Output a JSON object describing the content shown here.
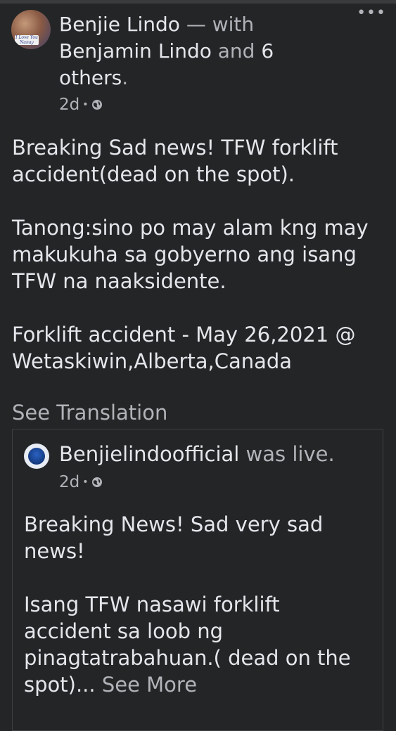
{
  "post": {
    "author": "Benjie Lindo",
    "with_text": "— with",
    "tagged": "Benjamin Lindo",
    "and_text": "and",
    "others": "6 others",
    "period": ".",
    "time": "2d",
    "visibility_icon": "globe-icon",
    "avatar_badge": "I Love You Nanay",
    "body": [
      "Breaking Sad news! TFW forklift accident(dead on the spot).",
      "Tanong:sino po may alam kng may makukuha sa gobyerno ang isang TFW na naaksidente.",
      "Forklift accident - May 26,2021 @ Wetaskiwin,Alberta,Canada"
    ],
    "see_translation": "See Translation",
    "more_icon": "ellipsis-icon"
  },
  "shared": {
    "page_name": "Benjielindoofficial",
    "status": "was live.",
    "time": "2d",
    "body": [
      "Breaking News! Sad very sad news!",
      "Isang TFW nasawi forklift accident sa loob ng pinagtatrabahuan.( dead on the spot)..."
    ],
    "see_more": "See More"
  },
  "colors": {
    "background": "#242526",
    "primary_text": "#e4e6eb",
    "secondary_text": "#b0b3b8",
    "border": "#3e4042"
  }
}
